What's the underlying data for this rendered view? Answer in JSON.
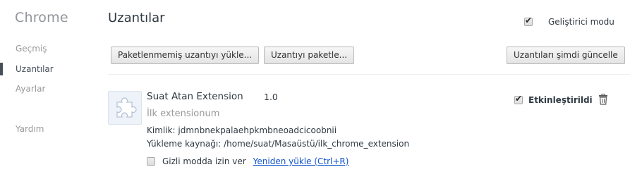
{
  "sidebar": {
    "brand": "Chrome",
    "items": [
      {
        "label": "Geçmiş",
        "selected": false
      },
      {
        "label": "Uzantılar",
        "selected": true
      },
      {
        "label": "Ayarlar",
        "selected": false
      },
      {
        "label": "Yardım",
        "selected": false
      }
    ]
  },
  "header": {
    "title": "Uzantılar",
    "developer_mode": {
      "label": "Geliştirici modu",
      "checked": true
    }
  },
  "toolbar": {
    "load_unpacked_label": "Paketlenmemiş uzantıyı yükle...",
    "pack_label": "Uzantıyı paketle...",
    "update_label": "Uzantıları şimdi güncelle"
  },
  "extension": {
    "name": "Suat Atan Extension",
    "version": "1.0",
    "description": "İlk extensionum",
    "id_line": "Kimlik: jdmnbnekpalaehpkmbneoadcicoobnii",
    "source_line": "Yükleme kaynağı: /home/suat/Masaüstü/ilk_chrome_extension",
    "incognito": {
      "label": "Gizli modda izin ver",
      "checked": false
    },
    "reload_label": "Yeniden yükle (Ctrl+R)",
    "enabled": {
      "label": "Etkinleştirildi",
      "checked": true
    },
    "icon": "puzzle-piece-icon"
  },
  "colors": {
    "link": "#1155cc",
    "nav_selected": "#464e5a",
    "muted": "#999999"
  }
}
